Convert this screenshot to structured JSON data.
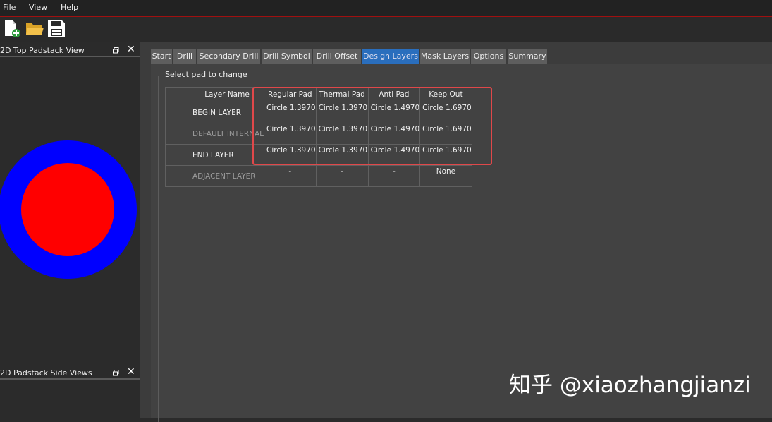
{
  "menubar": {
    "items": [
      "File",
      "View",
      "Help"
    ]
  },
  "toolbar": {
    "icons": [
      "new-file-icon",
      "open-folder-icon",
      "save-icon"
    ]
  },
  "left_panel": {
    "top_view": {
      "title": "2D Top Padstack View",
      "outer_color": "#0000ff",
      "inner_color": "#ff0000"
    },
    "side_view": {
      "title": "2D Padstack Side Views"
    }
  },
  "tabs": [
    {
      "label": "Start",
      "active": false
    },
    {
      "label": "Drill",
      "active": false
    },
    {
      "label": "Secondary Drill",
      "active": false
    },
    {
      "label": "Drill Symbol",
      "active": false
    },
    {
      "label": "Drill Offset",
      "active": false
    },
    {
      "label": "Design Layers",
      "active": true
    },
    {
      "label": "Mask Layers",
      "active": false
    },
    {
      "label": "Options",
      "active": false
    },
    {
      "label": "Summary",
      "active": false
    }
  ],
  "group": {
    "label": "Select pad to change"
  },
  "table": {
    "headers": [
      "Layer Name",
      "Regular Pad",
      "Thermal Pad",
      "Anti Pad",
      "Keep Out"
    ],
    "rows": [
      {
        "layer": "BEGIN LAYER",
        "dim": false,
        "cells": [
          "Circle 1.3970",
          "Circle 1.3970",
          "Circle 1.4970",
          "Circle 1.6970"
        ]
      },
      {
        "layer": "DEFAULT INTERNAL",
        "dim": true,
        "cells": [
          "Circle 1.3970",
          "Circle 1.3970",
          "Circle 1.4970",
          "Circle 1.6970"
        ]
      },
      {
        "layer": "END LAYER",
        "dim": false,
        "cells": [
          "Circle 1.3970",
          "Circle 1.3970",
          "Circle 1.4970",
          "Circle 1.6970"
        ]
      },
      {
        "layer": "ADJACENT LAYER",
        "dim": true,
        "cells": [
          "-",
          "-",
          "-",
          "None"
        ]
      }
    ]
  },
  "highlight_color": "#e0484a",
  "watermark": "知乎 @xiaozhangjianzi"
}
